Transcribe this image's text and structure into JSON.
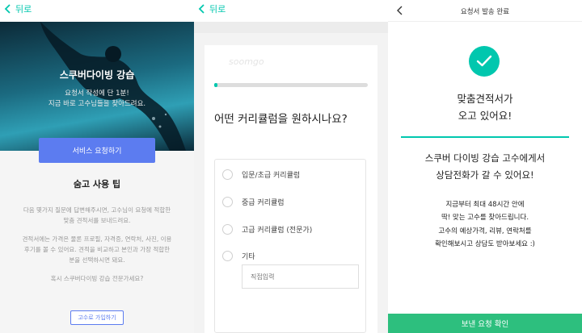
{
  "panel1": {
    "back_label": "뒤로",
    "hero_title": "스쿠버다이빙 강습",
    "hero_sub1": "요청서 작성에 단 1분!",
    "hero_sub2": "지금 바로 고수님들을 찾아드려요.",
    "request_button": "서비스 요청하기",
    "tip_title": "숨고 사용 팁",
    "tip_p1_line1": "다음 몇가지 질문에 답변해주시면, 고수님이 요청에 적합한",
    "tip_p1_line2": "맞춤 견적서를 보내드려요.",
    "tip_p2_line1": "견적서에는 가격은 물론 프로필, 자격증, 연락처, 사진, 이용",
    "tip_p2_line2": "후기를 볼 수 있어요. 견적을 비교하고 본인과 가장 적합한",
    "tip_p2_line3": "분을 선택하시면 돼요.",
    "tip_question": "혹시 스쿠버다이빙 강습 전문가세요?",
    "join_button": "고수로 가입하기"
  },
  "panel2": {
    "back_label": "뒤로",
    "progress_fraction": 0.02,
    "question": "어떤 커리큘럼을 원하시나요?",
    "options": [
      "입문/초급 커리큘럼",
      "중급 커리큘럼",
      "고급 커리큘럼 (전문가)",
      "기타"
    ],
    "direct_input_placeholder": "직접입력"
  },
  "panel3": {
    "header_title": "요청서 발송 완료",
    "headline_line1": "맞춤견적서가",
    "headline_line2": "오고 있어요!",
    "message_line1": "스쿠버 다이빙 강습 고수에게서",
    "message_line2": "상담전화가 갈 수 있어요!",
    "detail_line1": "지금부터 최대 48시간 안에",
    "detail_line2": "딱! 맞는 고수를 찾아드립니다.",
    "detail_line3": "고수의 예상가격, 리뷰, 연락처를",
    "detail_line4": "확인해보시고 상담도 받아보세요 :)",
    "confirm_button": "보낸 요청 확인"
  },
  "colors": {
    "accent_teal": "#00c7ae",
    "button_blue": "#5c7cf0",
    "confirm_green": "#2dbf7e"
  }
}
